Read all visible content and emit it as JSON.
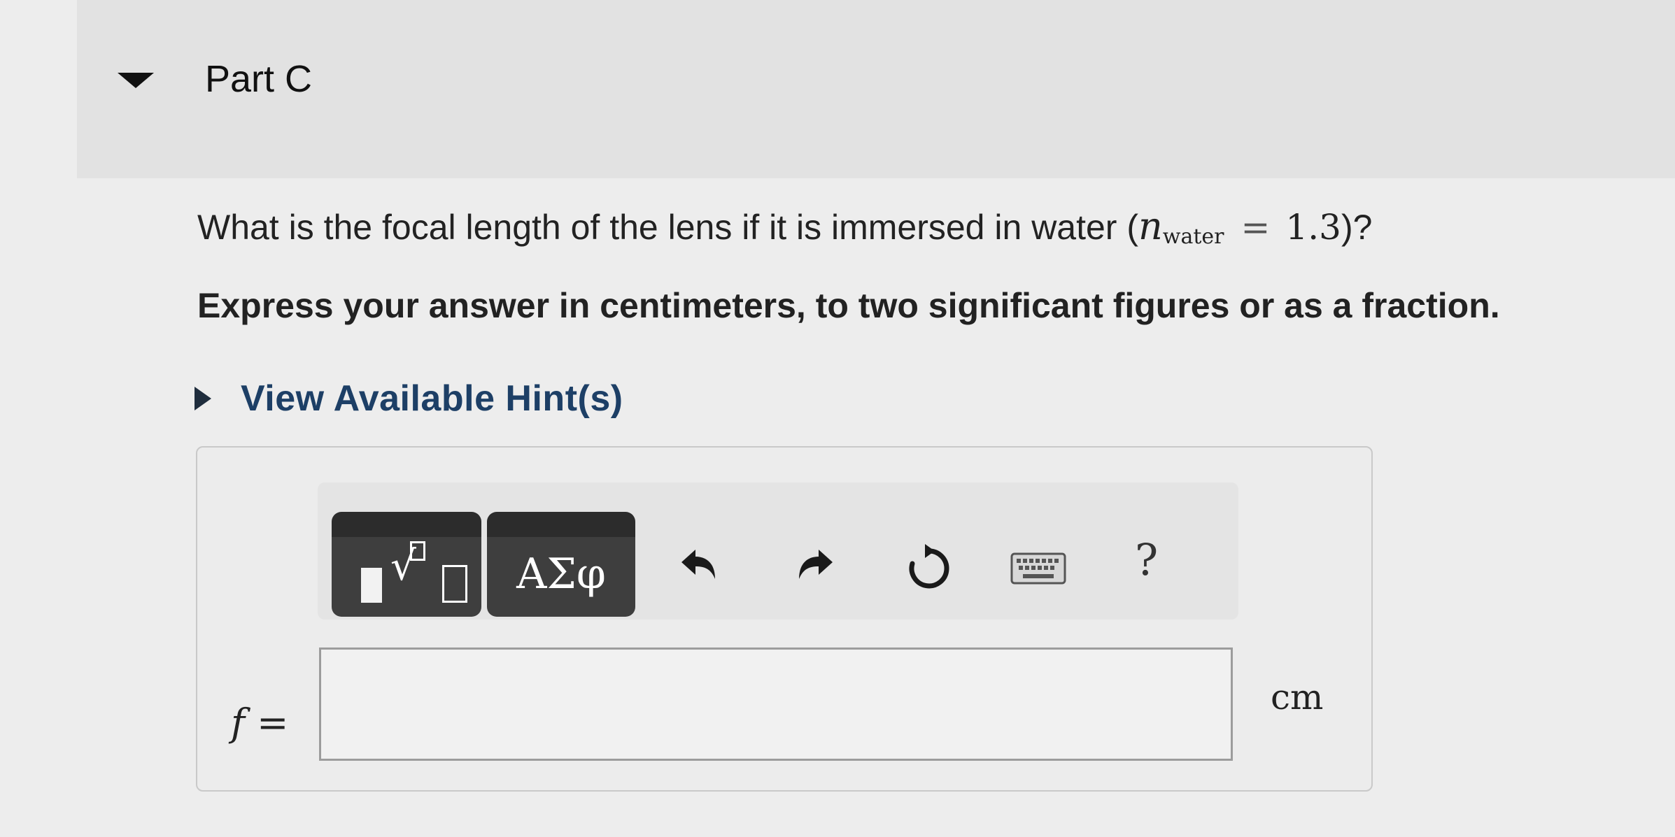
{
  "part": {
    "title": "Part C",
    "caret_icon": "caret-down-icon"
  },
  "question": {
    "text_before": "What is the focal length of the lens if it is immersed in water (",
    "math_var": "n",
    "math_sub": "water",
    "math_eq": "=",
    "math_value": "1.3",
    "text_after": ")?"
  },
  "instruction": "Express your answer in centimeters, to two significant figures or as a fraction.",
  "hint": {
    "label": "View Available Hint(s)",
    "caret_icon": "caret-right-icon"
  },
  "toolbar": {
    "templates_icon": "templates-icon",
    "greek_label": "ΑΣφ",
    "undo_icon": "undo-icon",
    "redo_icon": "redo-icon",
    "reset_icon": "reset-icon",
    "keyboard_icon": "keyboard-icon",
    "help_label": "?"
  },
  "answer": {
    "variable": "f",
    "equals": "=",
    "value": "",
    "unit": "cm"
  },
  "colors": {
    "background": "#ededed",
    "header_band": "#e2e2e2",
    "hint_link": "#1d3f66",
    "toolbar_button": "#3e3e3e"
  }
}
